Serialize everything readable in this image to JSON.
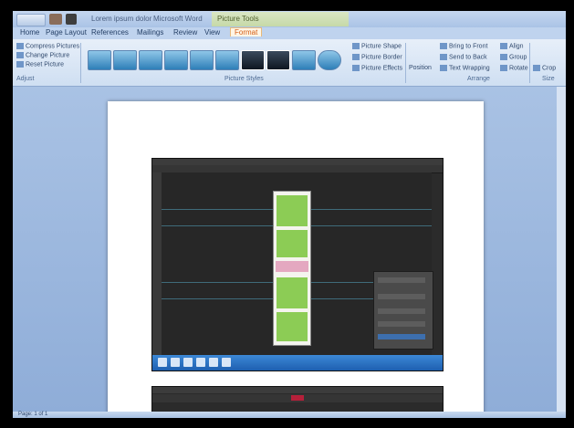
{
  "window": {
    "document_title": "Lorem ipsum dolor",
    "app_name": "Microsoft Word",
    "contextual_tab_group": "Picture Tools"
  },
  "tabs": [
    "Home",
    "Page Layout",
    "References",
    "Mailings",
    "Review",
    "View",
    "Format"
  ],
  "ribbon": {
    "adjust": {
      "label": "Adjust",
      "commands": [
        "Compress Pictures",
        "Change Picture",
        "Reset Picture"
      ]
    },
    "picture_styles": {
      "label": "Picture Styles",
      "commands": [
        "Picture Shape",
        "Picture Border",
        "Picture Effects"
      ]
    },
    "arrange": {
      "label": "Arrange",
      "commands": [
        "Position",
        "Bring to Front",
        "Send to Back",
        "Text Wrapping",
        "Align",
        "Group",
        "Rotate"
      ]
    },
    "size": {
      "label": "Size",
      "commands": [
        "Crop"
      ]
    }
  },
  "status_bar": {
    "page": "Page: 1 of 1"
  },
  "colors": {
    "accent_orange": "#d45c14",
    "ribbon_blue": "#cfdff2",
    "canvas_dark": "#272727",
    "artwork_green": "#8ccc55"
  }
}
